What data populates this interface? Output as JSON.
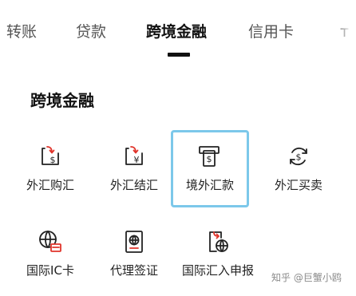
{
  "tabs": [
    {
      "label": "转账",
      "active": false
    },
    {
      "label": "贷款",
      "active": false
    },
    {
      "label": "跨境金融",
      "active": true
    },
    {
      "label": "信用卡",
      "active": false
    },
    {
      "label": "т",
      "active": false
    }
  ],
  "section_title": "跨境金融",
  "items": [
    {
      "label": "外汇购汇",
      "icon": "exchange-purchase-dollar-icon",
      "highlighted": false
    },
    {
      "label": "外汇结汇",
      "icon": "exchange-settlement-yuan-icon",
      "highlighted": false
    },
    {
      "label": "境外汇款",
      "icon": "overseas-remittance-atm-icon",
      "highlighted": true
    },
    {
      "label": "外汇买卖",
      "icon": "forex-trading-cycle-dollar-icon",
      "highlighted": false
    },
    {
      "label": "国际IC卡",
      "icon": "international-card-globe-icon",
      "highlighted": false
    },
    {
      "label": "代理签证",
      "icon": "visa-passport-icon",
      "highlighted": false
    },
    {
      "label": "国际汇入申报",
      "icon": "international-inbound-declaration-icon",
      "highlighted": false
    }
  ],
  "highlight_color": "#7cc8ea",
  "accent_color": "#e0342b",
  "watermark": "知乎 @巨蟹小鸥"
}
